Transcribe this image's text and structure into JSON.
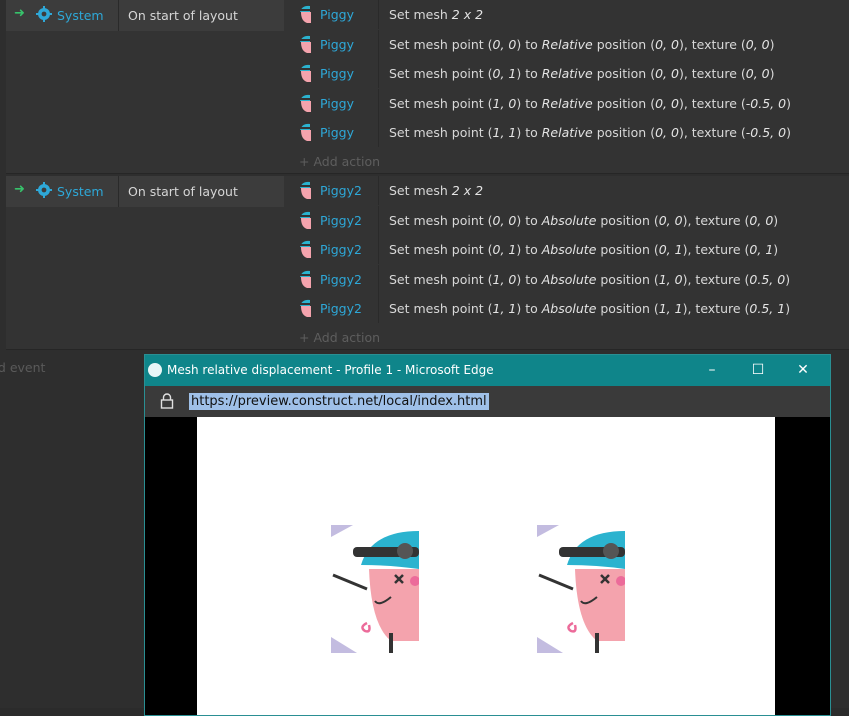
{
  "events": [
    {
      "condition": {
        "object": "System",
        "text": "On start of layout"
      },
      "actions": [
        {
          "object": "Piggy",
          "parts": [
            {
              "t": "Set mesh "
            },
            {
              "i": "2 x 2"
            }
          ]
        },
        {
          "object": "Piggy",
          "parts": [
            {
              "t": "Set mesh point ("
            },
            {
              "i": "0, 0"
            },
            {
              "t": ") to "
            },
            {
              "i": "Relative"
            },
            {
              "t": " position ("
            },
            {
              "i": "0, 0"
            },
            {
              "t": "), texture ("
            },
            {
              "i": "0, 0"
            },
            {
              "t": ")"
            }
          ]
        },
        {
          "object": "Piggy",
          "parts": [
            {
              "t": "Set mesh point ("
            },
            {
              "i": "0, 1"
            },
            {
              "t": ") to "
            },
            {
              "i": "Relative"
            },
            {
              "t": " position ("
            },
            {
              "i": "0, 0"
            },
            {
              "t": "), texture ("
            },
            {
              "i": "0, 0"
            },
            {
              "t": ")"
            }
          ]
        },
        {
          "object": "Piggy",
          "parts": [
            {
              "t": "Set mesh point ("
            },
            {
              "i": "1, 0"
            },
            {
              "t": ") to "
            },
            {
              "i": "Relative"
            },
            {
              "t": " position ("
            },
            {
              "i": "0, 0"
            },
            {
              "t": "), texture ("
            },
            {
              "i": "-0.5, 0"
            },
            {
              "t": ")"
            }
          ]
        },
        {
          "object": "Piggy",
          "parts": [
            {
              "t": "Set mesh point ("
            },
            {
              "i": "1, 1"
            },
            {
              "t": ") to "
            },
            {
              "i": "Relative"
            },
            {
              "t": " position ("
            },
            {
              "i": "0, 0"
            },
            {
              "t": "), texture ("
            },
            {
              "i": "-0.5, 0"
            },
            {
              "t": ")"
            }
          ]
        }
      ],
      "add_action": "+ Add action"
    },
    {
      "condition": {
        "object": "System",
        "text": "On start of layout"
      },
      "actions": [
        {
          "object": "Piggy2",
          "parts": [
            {
              "t": "Set mesh "
            },
            {
              "i": "2 x 2"
            }
          ]
        },
        {
          "object": "Piggy2",
          "parts": [
            {
              "t": "Set mesh point ("
            },
            {
              "i": "0, 0"
            },
            {
              "t": ") to "
            },
            {
              "i": "Absolute"
            },
            {
              "t": " position ("
            },
            {
              "i": "0, 0"
            },
            {
              "t": "), texture ("
            },
            {
              "i": "0, 0"
            },
            {
              "t": ")"
            }
          ]
        },
        {
          "object": "Piggy2",
          "parts": [
            {
              "t": "Set mesh point ("
            },
            {
              "i": "0, 1"
            },
            {
              "t": ") to "
            },
            {
              "i": "Absolute"
            },
            {
              "t": " position ("
            },
            {
              "i": "0, 1"
            },
            {
              "t": "), texture ("
            },
            {
              "i": "0, 1"
            },
            {
              "t": ")"
            }
          ]
        },
        {
          "object": "Piggy2",
          "parts": [
            {
              "t": "Set mesh point ("
            },
            {
              "i": "1, 0"
            },
            {
              "t": ") to "
            },
            {
              "i": "Absolute"
            },
            {
              "t": " position ("
            },
            {
              "i": "1, 0"
            },
            {
              "t": "), texture ("
            },
            {
              "i": "0.5, 0"
            },
            {
              "t": ")"
            }
          ]
        },
        {
          "object": "Piggy2",
          "parts": [
            {
              "t": "Set mesh point ("
            },
            {
              "i": "1, 1"
            },
            {
              "t": ") to "
            },
            {
              "i": "Absolute"
            },
            {
              "t": " position ("
            },
            {
              "i": "1, 1"
            },
            {
              "t": "), texture ("
            },
            {
              "i": "0.5, 1"
            },
            {
              "t": ")"
            }
          ]
        }
      ],
      "add_action": "+ Add action"
    }
  ],
  "add_event": "dd event",
  "browser": {
    "title": "Mesh relative displacement - Profile 1 - Microsoft Edge",
    "url": "https://preview.construct.net/local/index.html",
    "minimize": "–",
    "maximize": "☐",
    "close": "✕"
  },
  "colors": {
    "accent": "#2ea8d8",
    "titlebar": "#0f858a",
    "arrow": "#37c26b"
  },
  "icons": {
    "condition": "gear-icon",
    "action_object": "piggy-sprite-icon",
    "lock": "lock-icon"
  }
}
